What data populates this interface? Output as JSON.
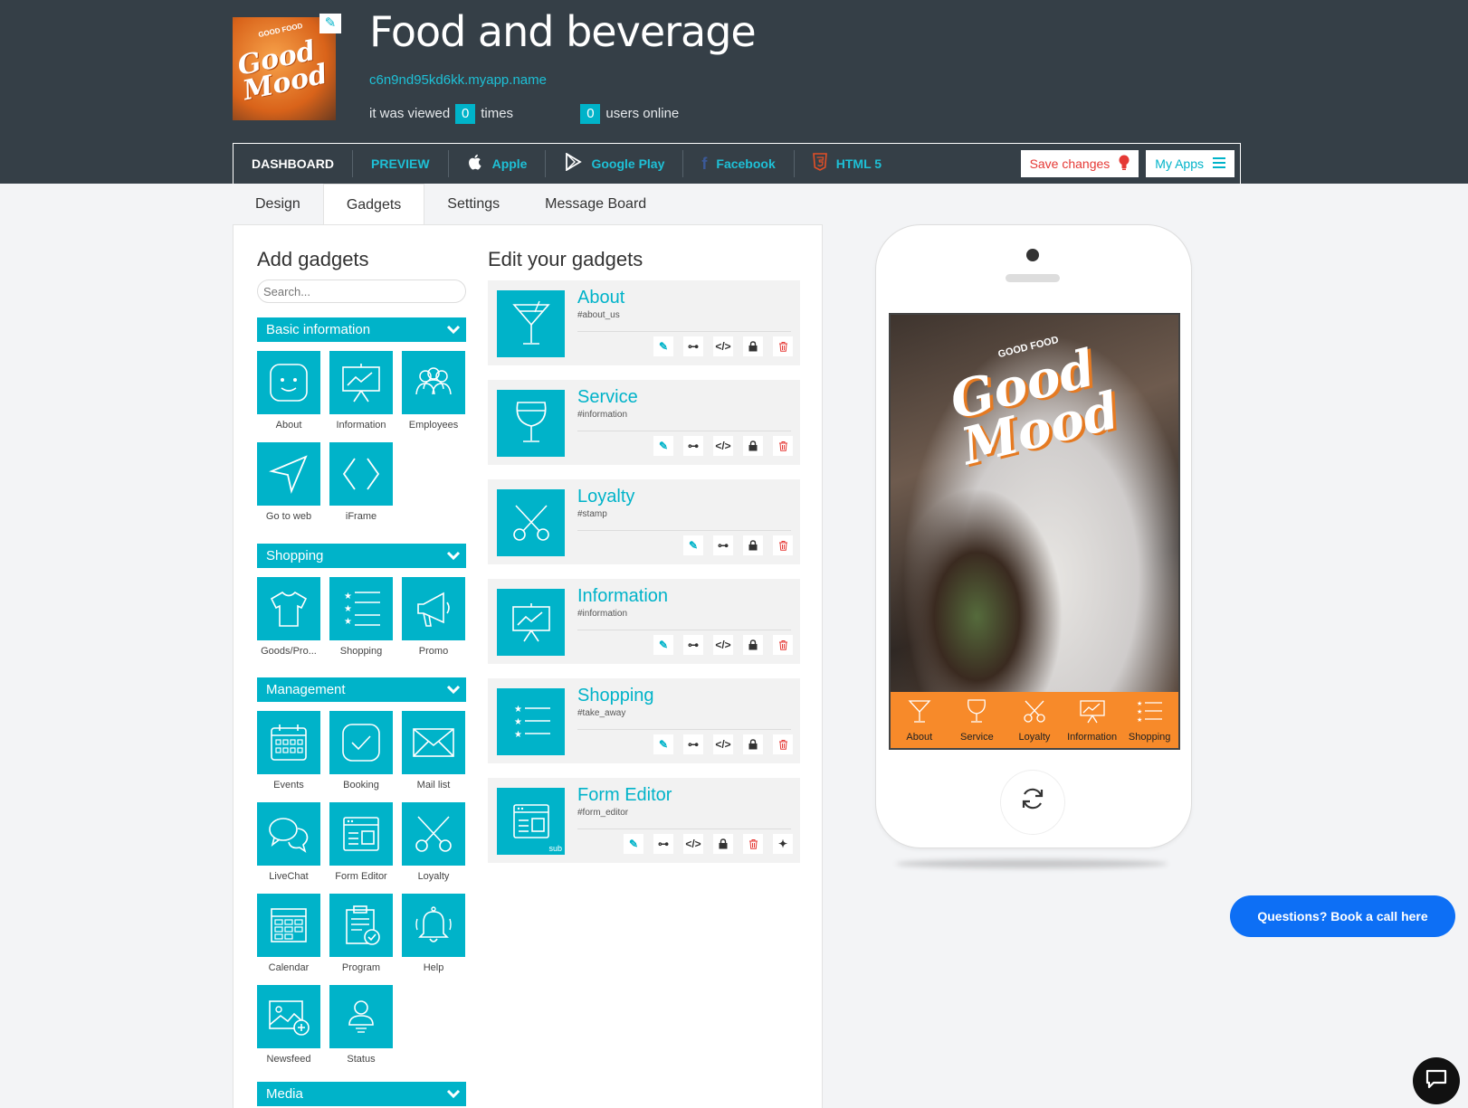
{
  "header": {
    "title": "Food and beverage",
    "url": "c6n9nd95kd6kk.myapp.name",
    "viewed_prefix": "it was viewed",
    "viewed_count": "0",
    "viewed_suffix": "times",
    "online_count": "0",
    "online_suffix": "users online",
    "logo_small_text": "GOOD FOOD",
    "logo_text": "Good Mood"
  },
  "nav": {
    "items": [
      {
        "label": "DASHBOARD"
      },
      {
        "label": "PREVIEW"
      },
      {
        "label": "Apple",
        "icon": "apple-icon"
      },
      {
        "label": "Google Play",
        "icon": "google-play-icon"
      },
      {
        "label": "Facebook",
        "icon": "facebook-icon"
      },
      {
        "label": "HTML 5",
        "icon": "html5-icon"
      }
    ],
    "save_label": "Save changes",
    "myapps_label": "My Apps"
  },
  "tabs": [
    {
      "label": "Design"
    },
    {
      "label": "Gadgets",
      "active": true
    },
    {
      "label": "Settings"
    },
    {
      "label": "Message Board"
    }
  ],
  "add_gadgets": {
    "title": "Add gadgets",
    "search_placeholder": "Search...",
    "categories": [
      {
        "label": "Basic information",
        "gadgets": [
          "About",
          "Information",
          "Employees",
          "Go to web",
          "iFrame"
        ]
      },
      {
        "label": "Shopping",
        "gadgets": [
          "Goods/Pro...",
          "Shopping",
          "Promo"
        ]
      },
      {
        "label": "Management",
        "gadgets": [
          "Events",
          "Booking",
          "Mail list",
          "LiveChat",
          "Form Editor",
          "Loyalty",
          "Calendar",
          "Program",
          "Help",
          "Newsfeed",
          "Status"
        ]
      },
      {
        "label": "Media",
        "gadgets": []
      }
    ]
  },
  "edit_gadgets": {
    "title": "Edit your gadgets",
    "items": [
      {
        "title": "About",
        "tag": "#about_us",
        "icon": "cocktail-icon"
      },
      {
        "title": "Service",
        "tag": "#information",
        "icon": "wine-glass-icon"
      },
      {
        "title": "Loyalty",
        "tag": "#stamp",
        "icon": "scissors-icon"
      },
      {
        "title": "Information",
        "tag": "#information",
        "icon": "presentation-icon"
      },
      {
        "title": "Shopping",
        "tag": "#take_away",
        "icon": "list-icon"
      },
      {
        "title": "Form Editor",
        "tag": "#form_editor",
        "icon": "form-icon",
        "badge": "sub"
      }
    ]
  },
  "phone": {
    "tabbar": [
      "About",
      "Service",
      "Loyalty",
      "Information",
      "Shopping"
    ],
    "tabbar_color": "#f78a2a",
    "screen_logo_small": "GOOD FOOD",
    "screen_logo": "Good Mood"
  },
  "book_call": "Questions? Book a call here",
  "colors": {
    "accent": "#00b3c9",
    "header_bg": "#353f47",
    "danger": "#e53935",
    "cta": "#0d6ff5"
  }
}
